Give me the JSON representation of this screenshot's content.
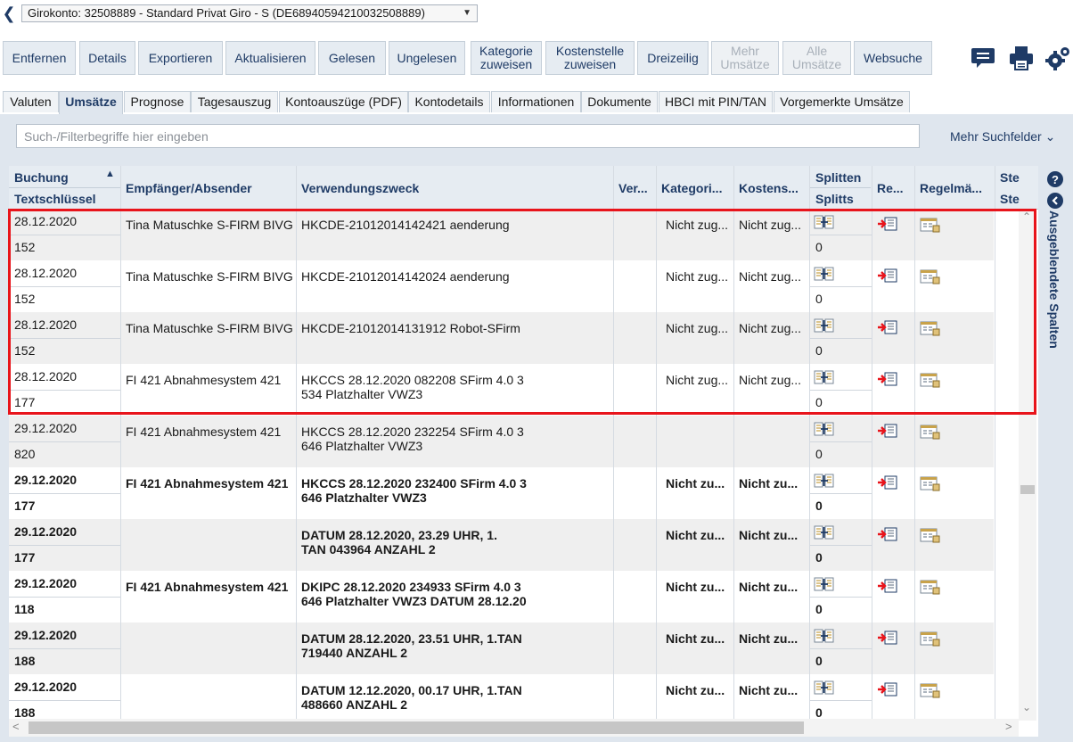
{
  "account": {
    "label": "Girokonto: 32508889 - Standard Privat Giro - S (DE68940594210032508889)"
  },
  "toolbar": [
    {
      "label": "Entfernen",
      "disabled": false
    },
    {
      "label": "Details",
      "disabled": false
    },
    {
      "label": "Exportieren",
      "disabled": false
    },
    {
      "label": "Aktualisieren",
      "disabled": false
    },
    {
      "label": "Gelesen",
      "disabled": false
    },
    {
      "label": "Ungelesen",
      "disabled": false
    },
    {
      "label": "Kategorie\nzuweisen",
      "disabled": false
    },
    {
      "label": "Kostenstelle\nzuweisen",
      "disabled": false
    },
    {
      "label": "Dreizeilig",
      "disabled": false
    },
    {
      "label": "Mehr\nUmsätze",
      "disabled": true
    },
    {
      "label": "Alle\nUmsätze",
      "disabled": true
    },
    {
      "label": "Websuche",
      "disabled": false
    }
  ],
  "tool_icons": [
    "chat-icon",
    "printer-icon",
    "settings-gears-icon"
  ],
  "tabs": [
    "Valuten",
    "Umsätze",
    "Prognose",
    "Tagesauszug",
    "Kontoauszüge (PDF)",
    "Kontodetails",
    "Informationen",
    "Dokumente",
    "HBCI mit PIN/TAN",
    "Vorgemerkte Umsätze"
  ],
  "active_tab": "Umsätze",
  "search": {
    "placeholder": "Such-/Filterbegriffe hier eingeben",
    "more_fields": "Mehr Suchfelder"
  },
  "columns": {
    "buchung": "Buchung",
    "textschluessel": "Textschlüssel",
    "empfaenger": "Empfänger/Absender",
    "verwendungszweck": "Verwendungszweck",
    "ver": "Ver...",
    "kategorie": "Kategori...",
    "kostenstelle": "Kostens...",
    "splitten": "Splitten",
    "splitts": "Splitts",
    "re": "Re...",
    "regelmaessig": "Regelmä...",
    "ste1": "Ste",
    "ste2": "Ste"
  },
  "rows": [
    {
      "date": "28.12.2020",
      "code": "152",
      "name": "Tina Matuschke S-FIRM BIVG",
      "purpose": "HKCDE-21012014142421 aenderung",
      "kat": "Nicht zug...",
      "kost": "Nicht zug...",
      "splitts": "0",
      "bold": false
    },
    {
      "date": "28.12.2020",
      "code": "152",
      "name": "Tina Matuschke S-FIRM BIVG",
      "purpose": "HKCDE-21012014142024 aenderung",
      "kat": "Nicht zug...",
      "kost": "Nicht zug...",
      "splitts": "0",
      "bold": false
    },
    {
      "date": "28.12.2020",
      "code": "152",
      "name": "Tina Matuschke S-FIRM BIVG",
      "purpose": "HKCDE-21012014131912 Robot-SFirm",
      "kat": "Nicht zug...",
      "kost": "Nicht zug...",
      "splitts": "0",
      "bold": false
    },
    {
      "date": "28.12.2020",
      "code": "177",
      "name": "FI 421 Abnahmesystem 421",
      "purpose": "HKCCS 28.12.2020 082208 SFirm 4.0 3\n534 Platzhalter VWZ3",
      "kat": "Nicht zug...",
      "kost": "Nicht zug...",
      "splitts": "0",
      "bold": false
    },
    {
      "date": "29.12.2020",
      "code": "820",
      "name": "FI 421 Abnahmesystem 421",
      "purpose": "HKCCS 28.12.2020 232254 SFirm 4.0 3\n646 Platzhalter VWZ3",
      "kat": "",
      "kost": "",
      "splitts": "0",
      "bold": false
    },
    {
      "date": "29.12.2020",
      "code": "177",
      "name": "FI 421 Abnahmesystem 421",
      "purpose": "HKCCS 28.12.2020 232400 SFirm 4.0 3\n646 Platzhalter VWZ3",
      "kat": "Nicht zu...",
      "kost": "Nicht zu...",
      "splitts": "0",
      "bold": true
    },
    {
      "date": "29.12.2020",
      "code": "177",
      "name": "",
      "purpose": "DATUM 28.12.2020,      23.29 UHR, 1.\nTAN 043964     ANZAHL        2",
      "kat": "Nicht zu...",
      "kost": "Nicht zu...",
      "splitts": "0",
      "bold": true
    },
    {
      "date": "29.12.2020",
      "code": "118",
      "name": "FI 421 Abnahmesystem 421",
      "purpose": "DKIPC 28.12.2020 234933 SFirm 4.0 3\n646 Platzhalter VWZ3 DATUM 28.12.20",
      "kat": "Nicht zu...",
      "kost": "Nicht zu...",
      "splitts": "0",
      "bold": true
    },
    {
      "date": "29.12.2020",
      "code": "188",
      "name": "",
      "purpose": "DATUM 28.12.2020, 23.51 UHR, 1.TAN\n719440 ANZAHL        2",
      "kat": "Nicht zu...",
      "kost": "Nicht zu...",
      "splitts": "0",
      "bold": true
    },
    {
      "date": "29.12.2020",
      "code": "188",
      "name": "",
      "purpose": "DATUM 12.12.2020, 00.17 UHR, 1.TAN\n488660 ANZAHL        2",
      "kat": "Nicht zu...",
      "kost": "Nicht zu...",
      "splitts": "0",
      "bold": true
    }
  ],
  "side_panel": {
    "label": "Ausgeblendete Spalten"
  },
  "colors": {
    "accent": "#1f3b66",
    "highlight": "#e8141b",
    "row_alt": "#efefef"
  }
}
